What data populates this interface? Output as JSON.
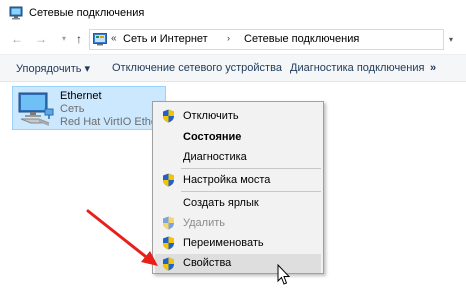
{
  "window": {
    "title": "Сетевые подключения"
  },
  "addressbar": {
    "overflow": "«",
    "crumbs": [
      "Сеть и Интернет",
      "Сетевые подключения"
    ],
    "separator": "›"
  },
  "toolbar": {
    "organize": "Упорядочить ▾",
    "disable_device": "Отключение сетевого устройства",
    "diagnose": "Диагностика подключения",
    "more": "»"
  },
  "connection": {
    "name": "Ethernet",
    "status": "Сеть",
    "device": "Red Hat VirtIO Ethernet Adapter"
  },
  "context_menu": {
    "items": [
      {
        "label": "Отключить",
        "icon": "shield-icon"
      },
      {
        "label": "Состояние"
      },
      {
        "label": "Диагностика"
      },
      {
        "label": "Настройка моста",
        "icon": "shield-icon"
      },
      {
        "label": "Создать ярлык"
      },
      {
        "label": "Удалить",
        "icon": "shield-icon",
        "disabled": true
      },
      {
        "label": "Переименовать",
        "icon": "shield-icon"
      },
      {
        "label": "Свойства",
        "icon": "shield-icon",
        "highlighted": true
      }
    ]
  },
  "colors": {
    "selection_fill": "#cce8ff",
    "selection_border": "#99d1ff",
    "toolbar_text": "#1e395b",
    "annotation_arrow": "#e8201c",
    "menu_bg": "#f2f2f2",
    "menu_highlight": "#dedede"
  }
}
